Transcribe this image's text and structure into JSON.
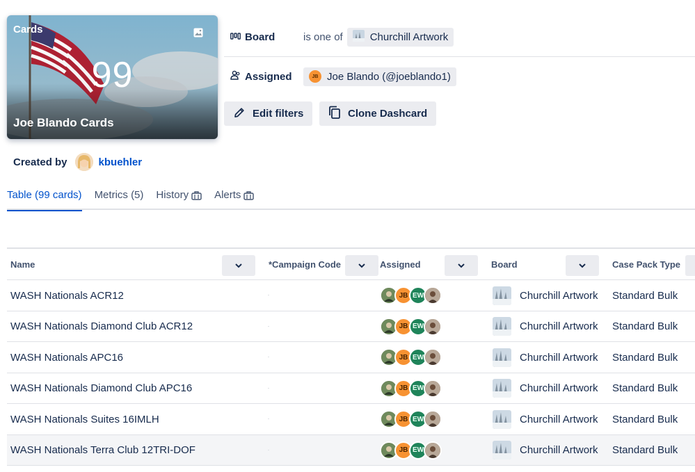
{
  "hero": {
    "label": "Cards",
    "count": "99",
    "title": "Joe Blando Cards"
  },
  "filters": {
    "board": {
      "label": "Board",
      "operator": "is one of",
      "value": "Churchill Artwork"
    },
    "assigned": {
      "label": "Assigned",
      "avatar_initials": "JB",
      "value": "Joe Blando (@joeblando1)"
    }
  },
  "actions": {
    "edit_label": "Edit filters",
    "clone_label": "Clone Dashcard"
  },
  "created": {
    "label": "Created by",
    "user": "kbuehler"
  },
  "tabs": [
    {
      "label": "Table (99 cards)",
      "active": true
    },
    {
      "label": "Metrics (5)",
      "active": false
    },
    {
      "label": "History",
      "active": false,
      "icon": "briefcase-icon"
    },
    {
      "label": "Alerts",
      "active": false,
      "icon": "briefcase-icon"
    }
  ],
  "table": {
    "columns": [
      "Name",
      "*Campaign Code",
      "Assigned",
      "Board",
      "Case Pack Type"
    ],
    "assigned_initials": [
      "JB",
      "EW"
    ],
    "rows": [
      {
        "name": "WASH Nationals ACR12",
        "board": "Churchill Artwork",
        "case_pack": "Standard Bulk"
      },
      {
        "name": "WASH Nationals Diamond Club ACR12",
        "board": "Churchill Artwork",
        "case_pack": "Standard Bulk"
      },
      {
        "name": "WASH Nationals APC16",
        "board": "Churchill Artwork",
        "case_pack": "Standard Bulk"
      },
      {
        "name": "WASH Nationals Diamond Club APC16",
        "board": "Churchill Artwork",
        "case_pack": "Standard Bulk"
      },
      {
        "name": "WASH Nationals Suites 16IMLH",
        "board": "Churchill Artwork",
        "case_pack": "Standard Bulk"
      },
      {
        "name": "WASH Nationals Terra Club 12TRI-DOF",
        "board": "Churchill Artwork",
        "case_pack": "Standard Bulk"
      }
    ]
  },
  "colors": {
    "link": "#0052cc",
    "text": "#172b4d",
    "chip_bg": "#ebecf0",
    "border": "#dfe1e6"
  }
}
